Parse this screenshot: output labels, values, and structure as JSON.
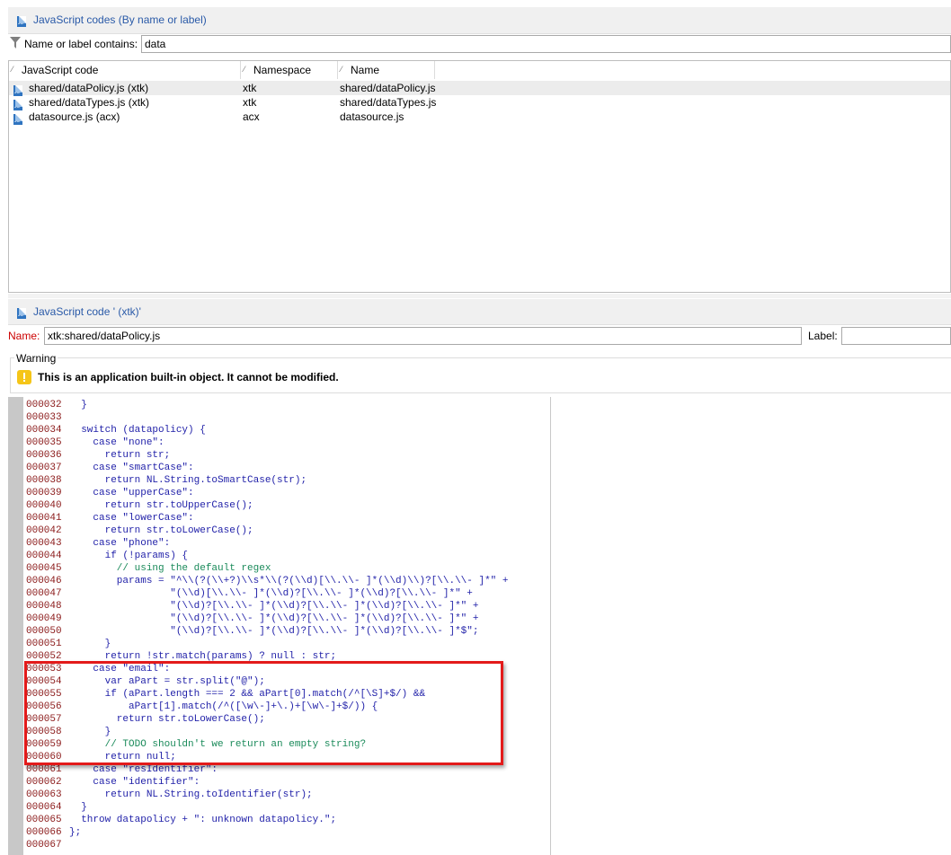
{
  "top_panel": {
    "title": "JavaScript codes (By name or label)",
    "filter_label": "Name or label contains:",
    "filter_value": "data",
    "columns": [
      "JavaScript code",
      "Namespace",
      "Name"
    ],
    "rows": [
      {
        "code": "shared/dataPolicy.js (xtk)",
        "namespace": "xtk",
        "name": "shared/dataPolicy.js"
      },
      {
        "code": "shared/dataTypes.js (xtk)",
        "namespace": "xtk",
        "name": "shared/dataTypes.js"
      },
      {
        "code": "datasource.js (acx)",
        "namespace": "acx",
        "name": "datasource.js"
      }
    ]
  },
  "detail_panel": {
    "title": "JavaScript code ' (xtk)'",
    "name_label": "Name:",
    "name_value": "xtk:shared/dataPolicy.js",
    "label_label": "Label:",
    "label_value": "",
    "warning_group": "Warning",
    "warning_text": "This is an application built-in object. It cannot be modified."
  },
  "code": {
    "lines": [
      {
        "n": "000032",
        "text": "  }"
      },
      {
        "n": "000033",
        "text": ""
      },
      {
        "n": "000034",
        "text": "  switch (datapolicy) {"
      },
      {
        "n": "000035",
        "text": "    case \"none\":"
      },
      {
        "n": "000036",
        "text": "      return str;"
      },
      {
        "n": "000037",
        "text": "    case \"smartCase\":"
      },
      {
        "n": "000038",
        "text": "      return NL.String.toSmartCase(str);"
      },
      {
        "n": "000039",
        "text": "    case \"upperCase\":"
      },
      {
        "n": "000040",
        "text": "      return str.toUpperCase();"
      },
      {
        "n": "000041",
        "text": "    case \"lowerCase\":"
      },
      {
        "n": "000042",
        "text": "      return str.toLowerCase();"
      },
      {
        "n": "000043",
        "text": "    case \"phone\":"
      },
      {
        "n": "000044",
        "text": "      if (!params) {"
      },
      {
        "n": "000045",
        "text": "        // using the default regex"
      },
      {
        "n": "000046",
        "text": "        params = \"^\\\\(?(\\\\+?)\\\\s*\\\\(?(\\\\d)[\\\\.\\\\- ]*(\\\\d)\\\\)?[\\\\.\\\\- ]*\" +"
      },
      {
        "n": "000047",
        "text": "                 \"(\\\\d)[\\\\.\\\\- ]*(\\\\d)?[\\\\.\\\\- ]*(\\\\d)?[\\\\.\\\\- ]*\" +"
      },
      {
        "n": "000048",
        "text": "                 \"(\\\\d)?[\\\\.\\\\- ]*(\\\\d)?[\\\\.\\\\- ]*(\\\\d)?[\\\\.\\\\- ]*\" +"
      },
      {
        "n": "000049",
        "text": "                 \"(\\\\d)?[\\\\.\\\\- ]*(\\\\d)?[\\\\.\\\\- ]*(\\\\d)?[\\\\.\\\\- ]*\" +"
      },
      {
        "n": "000050",
        "text": "                 \"(\\\\d)?[\\\\.\\\\- ]*(\\\\d)?[\\\\.\\\\- ]*(\\\\d)?[\\\\.\\\\- ]*$\";"
      },
      {
        "n": "000051",
        "text": "      }"
      },
      {
        "n": "000052",
        "text": "      return !str.match(params) ? null : str;"
      },
      {
        "n": "000053",
        "text": "    case \"email\":"
      },
      {
        "n": "000054",
        "text": "      var aPart = str.split(\"@\");"
      },
      {
        "n": "000055",
        "text": "      if (aPart.length === 2 && aPart[0].match(/^[\\S]+$/) &&"
      },
      {
        "n": "000056",
        "text": "          aPart[1].match(/^([\\w\\-]+\\.)+[\\w\\-]+$/)) {"
      },
      {
        "n": "000057",
        "text": "        return str.toLowerCase();"
      },
      {
        "n": "000058",
        "text": "      }"
      },
      {
        "n": "000059",
        "text": "      // TODO shouldn't we return an empty string?"
      },
      {
        "n": "000060",
        "text": "      return null;"
      },
      {
        "n": "000061",
        "text": "    case \"resIdentifier\":"
      },
      {
        "n": "000062",
        "text": "    case \"identifier\":"
      },
      {
        "n": "000063",
        "text": "      return NL.String.toIdentifier(str);"
      },
      {
        "n": "000064",
        "text": "  }"
      },
      {
        "n": "000065",
        "text": "  throw datapolicy + \": unknown datapolicy.\";"
      },
      {
        "n": "000066",
        "text": "};"
      },
      {
        "n": "000067",
        "text": ""
      }
    ]
  },
  "colors": {
    "header_title": "#2a5aa8",
    "name_label": "#cc0000",
    "highlight_box": "#e31a1a",
    "line_number": "#8b1a1a",
    "code_text": "#1f1fa8",
    "comment": "#1a8a5a",
    "warning_icon": "#f5c518"
  }
}
